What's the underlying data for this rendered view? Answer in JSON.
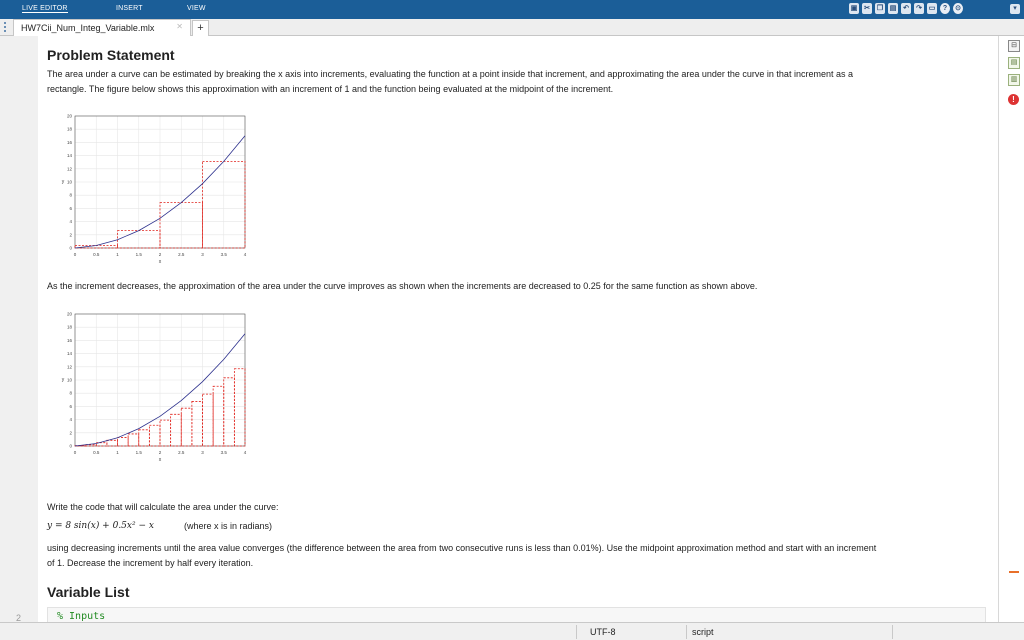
{
  "ribbon": {
    "tabs": [
      "LIVE EDITOR",
      "INSERT",
      "VIEW"
    ],
    "quick_access_icons": [
      "save-icon",
      "cut-icon",
      "copy-icon",
      "paste-icon",
      "undo-icon",
      "redo-icon",
      "switch-windows-icon",
      "help-icon",
      "minimize-ribbon-icon",
      "expand-icon"
    ]
  },
  "editor": {
    "file_tab": "HW7Cii_Num_Integ_Variable.mlx",
    "close_symbol": "✕",
    "new_tab_symbol": "+",
    "line_number": "2"
  },
  "content": {
    "problem_heading": "Problem Statement",
    "intro_line1": "The area under a curve can be estimated by breaking the x axis into increments, evaluating the function at a point inside that increment, and approximating the area under the curve in that increment as a",
    "intro_line2": "rectangle. The figure below shows this approximation with an increment of 1 and the function being evaluated at the midpoint of the increment.",
    "middle_text": "As the increment decreases, the approximation of the area under the curve improves as shown when the increments are decreased to 0.25 for the same function as shown above.",
    "task_text": "Write the code that will calculate the area under the curve:",
    "equation": "y = 8 sin(x) + 0.5x² − x",
    "equation_note": "(where x is in radians)",
    "converge_line1": "using decreasing increments until the area value converges (the difference between the area from two consecutive runs is less than 0.01%). Use the midpoint approximation method and start with an increment",
    "converge_line2": "of 1. Decrease the increment by half every iteration.",
    "variable_heading": "Variable List",
    "code_line": "% Inputs"
  },
  "status": {
    "encoding": "UTF-8",
    "file_type": "script"
  },
  "colors": {
    "ribbon_bg": "#1b5e98",
    "rect_line": "#e0211a",
    "curve_line": "#2b2f8c"
  },
  "chart_data": [
    {
      "type": "line",
      "title": "",
      "xlabel": "x",
      "ylabel": "y",
      "xlim": [
        0,
        4
      ],
      "ylim": [
        0,
        20
      ],
      "xticks": [
        "0",
        "0.5",
        "1",
        "1.5",
        "2",
        "2.5",
        "3",
        "3.5",
        "4"
      ],
      "yticks": [
        "0",
        "2",
        "4",
        "6",
        "8",
        "10",
        "12",
        "14",
        "16",
        "18",
        "20"
      ],
      "grid": true,
      "function": "x^2 + x/4",
      "increment": 1,
      "series": [
        {
          "type": "line",
          "x": [
            0,
            0.5,
            1,
            1.5,
            2,
            2.5,
            3,
            3.5,
            4
          ],
          "y": [
            0,
            0.38,
            1.25,
            2.63,
            4.5,
            6.88,
            9.75,
            13.13,
            17
          ]
        },
        {
          "type": "step-rectangles",
          "x_left": [
            0,
            1,
            2,
            3
          ],
          "heights": [
            0.38,
            2.63,
            6.88,
            13.13
          ]
        }
      ]
    },
    {
      "type": "line",
      "title": "",
      "xlabel": "x",
      "ylabel": "y",
      "xlim": [
        0,
        4
      ],
      "ylim": [
        0,
        20
      ],
      "xticks": [
        "0",
        "0.5",
        "1",
        "1.5",
        "2",
        "2.5",
        "3",
        "3.5",
        "4"
      ],
      "yticks": [
        "0",
        "2",
        "4",
        "6",
        "8",
        "10",
        "12",
        "14",
        "16",
        "18",
        "20"
      ],
      "grid": true,
      "function": "x^2 + x/4",
      "increment": 0.25,
      "series": [
        {
          "type": "line",
          "x": [
            0,
            0.5,
            1,
            1.5,
            2,
            2.5,
            3,
            3.5,
            4
          ],
          "y": [
            0,
            0.38,
            1.25,
            2.63,
            4.5,
            6.88,
            9.75,
            13.13,
            17
          ]
        },
        {
          "type": "step-rectangles",
          "x_left": [
            0,
            0.25,
            0.5,
            0.75,
            1,
            1.25,
            1.5,
            1.75,
            2,
            2.25,
            2.5,
            2.75,
            3,
            3.25,
            3.5,
            3.75
          ],
          "heights": [
            0.05,
            0.2,
            0.5,
            0.86,
            1.3,
            1.83,
            2.45,
            3.14,
            3.92,
            4.8,
            5.73,
            6.75,
            7.86,
            9.05,
            10.33,
            11.7
          ]
        }
      ]
    }
  ]
}
